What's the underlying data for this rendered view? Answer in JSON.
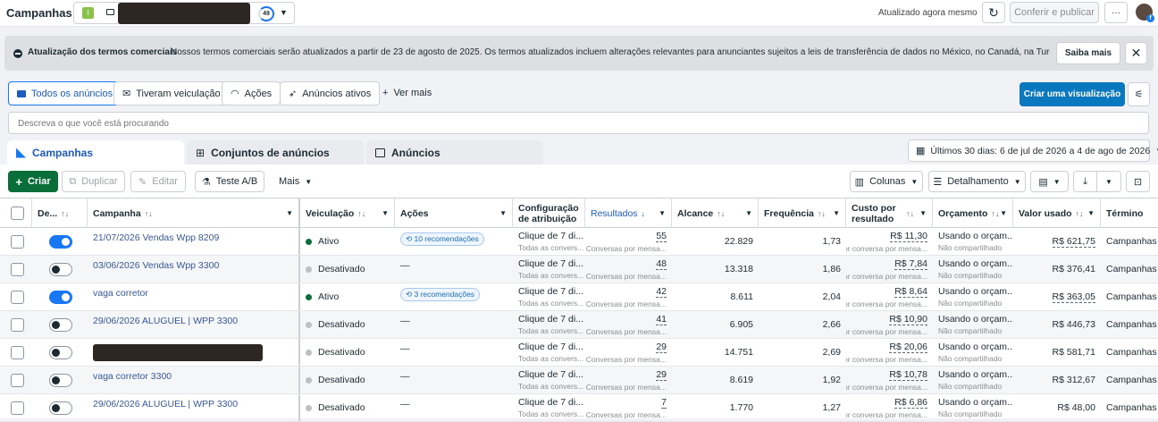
{
  "header": {
    "title": "Campanhas",
    "account_badge": "I",
    "score": "49",
    "updated": "Atualizado agora mesmo",
    "review_button": "Conferir e publicar",
    "more": "···"
  },
  "banner": {
    "title": "Atualização dos termos comerciais",
    "text": "Nossos termos comerciais serão atualizados a partir de 23 de agosto de 2025. Os termos atualizados incluem alterações relevantes para anunciantes sujeitos a leis de transferência de dados no México, no Canadá, na Turquia, no R…",
    "learn_more": "Saiba mais"
  },
  "filters": {
    "all_ads": "Todos os anúncios",
    "had_delivery": "Tiveram veiculação",
    "actions": "Ações",
    "active_ads": "Anúncios ativos",
    "see_more": "Ver mais",
    "create_view": "Criar uma visualização"
  },
  "search": {
    "placeholder": "Descreva o que você está procurando"
  },
  "tabs": {
    "campaigns": "Campanhas",
    "adsets": "Conjuntos de anúncios",
    "ads": "Anúncios"
  },
  "date_range": "Últimos 30 dias: 6 de jul de 2026 a 4 de ago de 2026",
  "toolbar": {
    "create": "Criar",
    "duplicate": "Duplicar",
    "edit": "Editar",
    "ab_test": "Teste A/B",
    "more": "Mais",
    "columns": "Colunas",
    "breakdown": "Detalhamento"
  },
  "columns": {
    "delivery_toggle": "De...",
    "campaign": "Campanha",
    "delivery": "Veiculação",
    "actions": "Ações",
    "attribution_l1": "Configuração",
    "attribution_l2": "de atribuição",
    "results": "Resultados",
    "reach": "Alcance",
    "frequency": "Frequência",
    "cost_l1": "Custo por",
    "cost_l2": "resultado",
    "budget": "Orçamento",
    "spent": "Valor usado",
    "end": "Término"
  },
  "rows": [
    {
      "name": "21/07/2026 Vendas Wpp 8209",
      "status": "Ativo",
      "reco": "10 recomendações",
      "attr": "Clique de 7 di...",
      "attr_sub": "Todas as convers...",
      "results": "55",
      "results_sub": "Conversas por mensa...",
      "reach": "22.829",
      "freq": "1,73",
      "cost": "R$ 11,30",
      "cost_sub": "Por conversa por mensa...",
      "budget": "Usando o orçam...",
      "budget_sub": "Não compartilhado",
      "spent": "R$ 621,75",
      "end": "Campanhas ..."
    },
    {
      "name": "03/06/2026 Vendas Wpp 3300",
      "status": "Desativado",
      "reco": "—",
      "attr": "Clique de 7 di...",
      "attr_sub": "Todas as convers...",
      "results": "48",
      "results_sub": "Conversas por mensa...",
      "reach": "13.318",
      "freq": "1,86",
      "cost": "R$ 7,84",
      "cost_sub": "Por conversa por mensa...",
      "budget": "Usando o orçam...",
      "budget_sub": "Não compartilhado",
      "spent": "R$ 376,41",
      "end": "Campanhas ..."
    },
    {
      "name": "vaga corretor",
      "status": "Ativo",
      "reco": "3 recomendações",
      "attr": "Clique de 7 di...",
      "attr_sub": "Todas as convers...",
      "results": "42",
      "results_sub": "Conversas por mensa...",
      "reach": "8.611",
      "freq": "2,04",
      "cost": "R$ 8,64",
      "cost_sub": "Por conversa por mensa...",
      "budget": "Usando o orçam...",
      "budget_sub": "Não compartilhado",
      "spent": "R$ 363,05",
      "end": "Campanhas ..."
    },
    {
      "name": "29/06/2026 ALUGUEL | WPP 3300",
      "status": "Desativado",
      "reco": "—",
      "attr": "Clique de 7 di...",
      "attr_sub": "Todas as convers...",
      "results": "41",
      "results_sub": "Conversas por mensa...",
      "reach": "6.905",
      "freq": "2,66",
      "cost": "R$ 10,90",
      "cost_sub": "Por conversa por mensa...",
      "budget": "Usando o orçam...",
      "budget_sub": "Não compartilhado",
      "spent": "R$ 446,73",
      "end": "Campanhas ..."
    },
    {
      "name": "",
      "status": "Desativado",
      "reco": "—",
      "attr": "Clique de 7 di...",
      "attr_sub": "Todas as convers...",
      "results": "29",
      "results_sub": "Conversas por mensa...",
      "reach": "14.751",
      "freq": "2,69",
      "cost": "R$ 20,06",
      "cost_sub": "Por conversa por mensa...",
      "budget": "Usando o orçam...",
      "budget_sub": "Não compartilhado",
      "spent": "R$ 581,71",
      "end": "Campanhas ..."
    },
    {
      "name": "vaga corretor 3300",
      "status": "Desativado",
      "reco": "—",
      "attr": "Clique de 7 di...",
      "attr_sub": "Todas as convers...",
      "results": "29",
      "results_sub": "Conversas por mensa...",
      "reach": "8.619",
      "freq": "1,92",
      "cost": "R$ 10,78",
      "cost_sub": "Por conversa por mensa...",
      "budget": "Usando o orçam...",
      "budget_sub": "Não compartilhado",
      "spent": "R$ 312,67",
      "end": "Campanhas ..."
    },
    {
      "name": "29/06/2026 ALUGUEL | WPP 3300",
      "status": "Desativado",
      "reco": "—",
      "attr": "Clique de 7 di...",
      "attr_sub": "Todas as convers...",
      "results": "7",
      "results_sub": "Conversas por mensa...",
      "reach": "1.770",
      "freq": "1,27",
      "cost": "R$ 6,86",
      "cost_sub": "Por conversa por mensa...",
      "budget": "Usando o orçam...",
      "budget_sub": "Não compartilhado",
      "spent": "R$ 48,00",
      "end": "Campanhas ..."
    }
  ],
  "colors": {
    "accent": "#0a78be",
    "create_green": "#0a6e3a",
    "active_dot": "#0a6e3a",
    "inactive_dot": "#bcc0c4",
    "link": "#385898"
  }
}
